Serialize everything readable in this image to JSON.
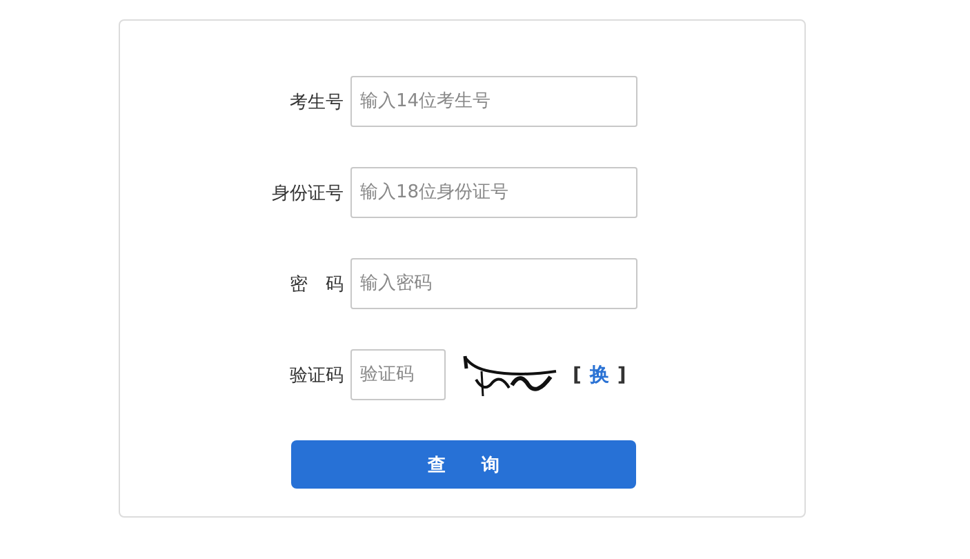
{
  "form": {
    "fields": [
      {
        "label": "考生号",
        "placeholder": "输入14位考生号",
        "kind": "text"
      },
      {
        "label": "身份证号",
        "placeholder": "输入18位身份证号",
        "kind": "text"
      },
      {
        "label": "密　码",
        "placeholder": "输入密码",
        "kind": "password"
      },
      {
        "label": "验证码",
        "placeholder": "验证码",
        "kind": "captcha"
      }
    ],
    "captcha": {
      "kind": "picture",
      "refresh_open": "[",
      "refresh_label": "换",
      "refresh_close": "]"
    },
    "submit": "查　　询"
  }
}
